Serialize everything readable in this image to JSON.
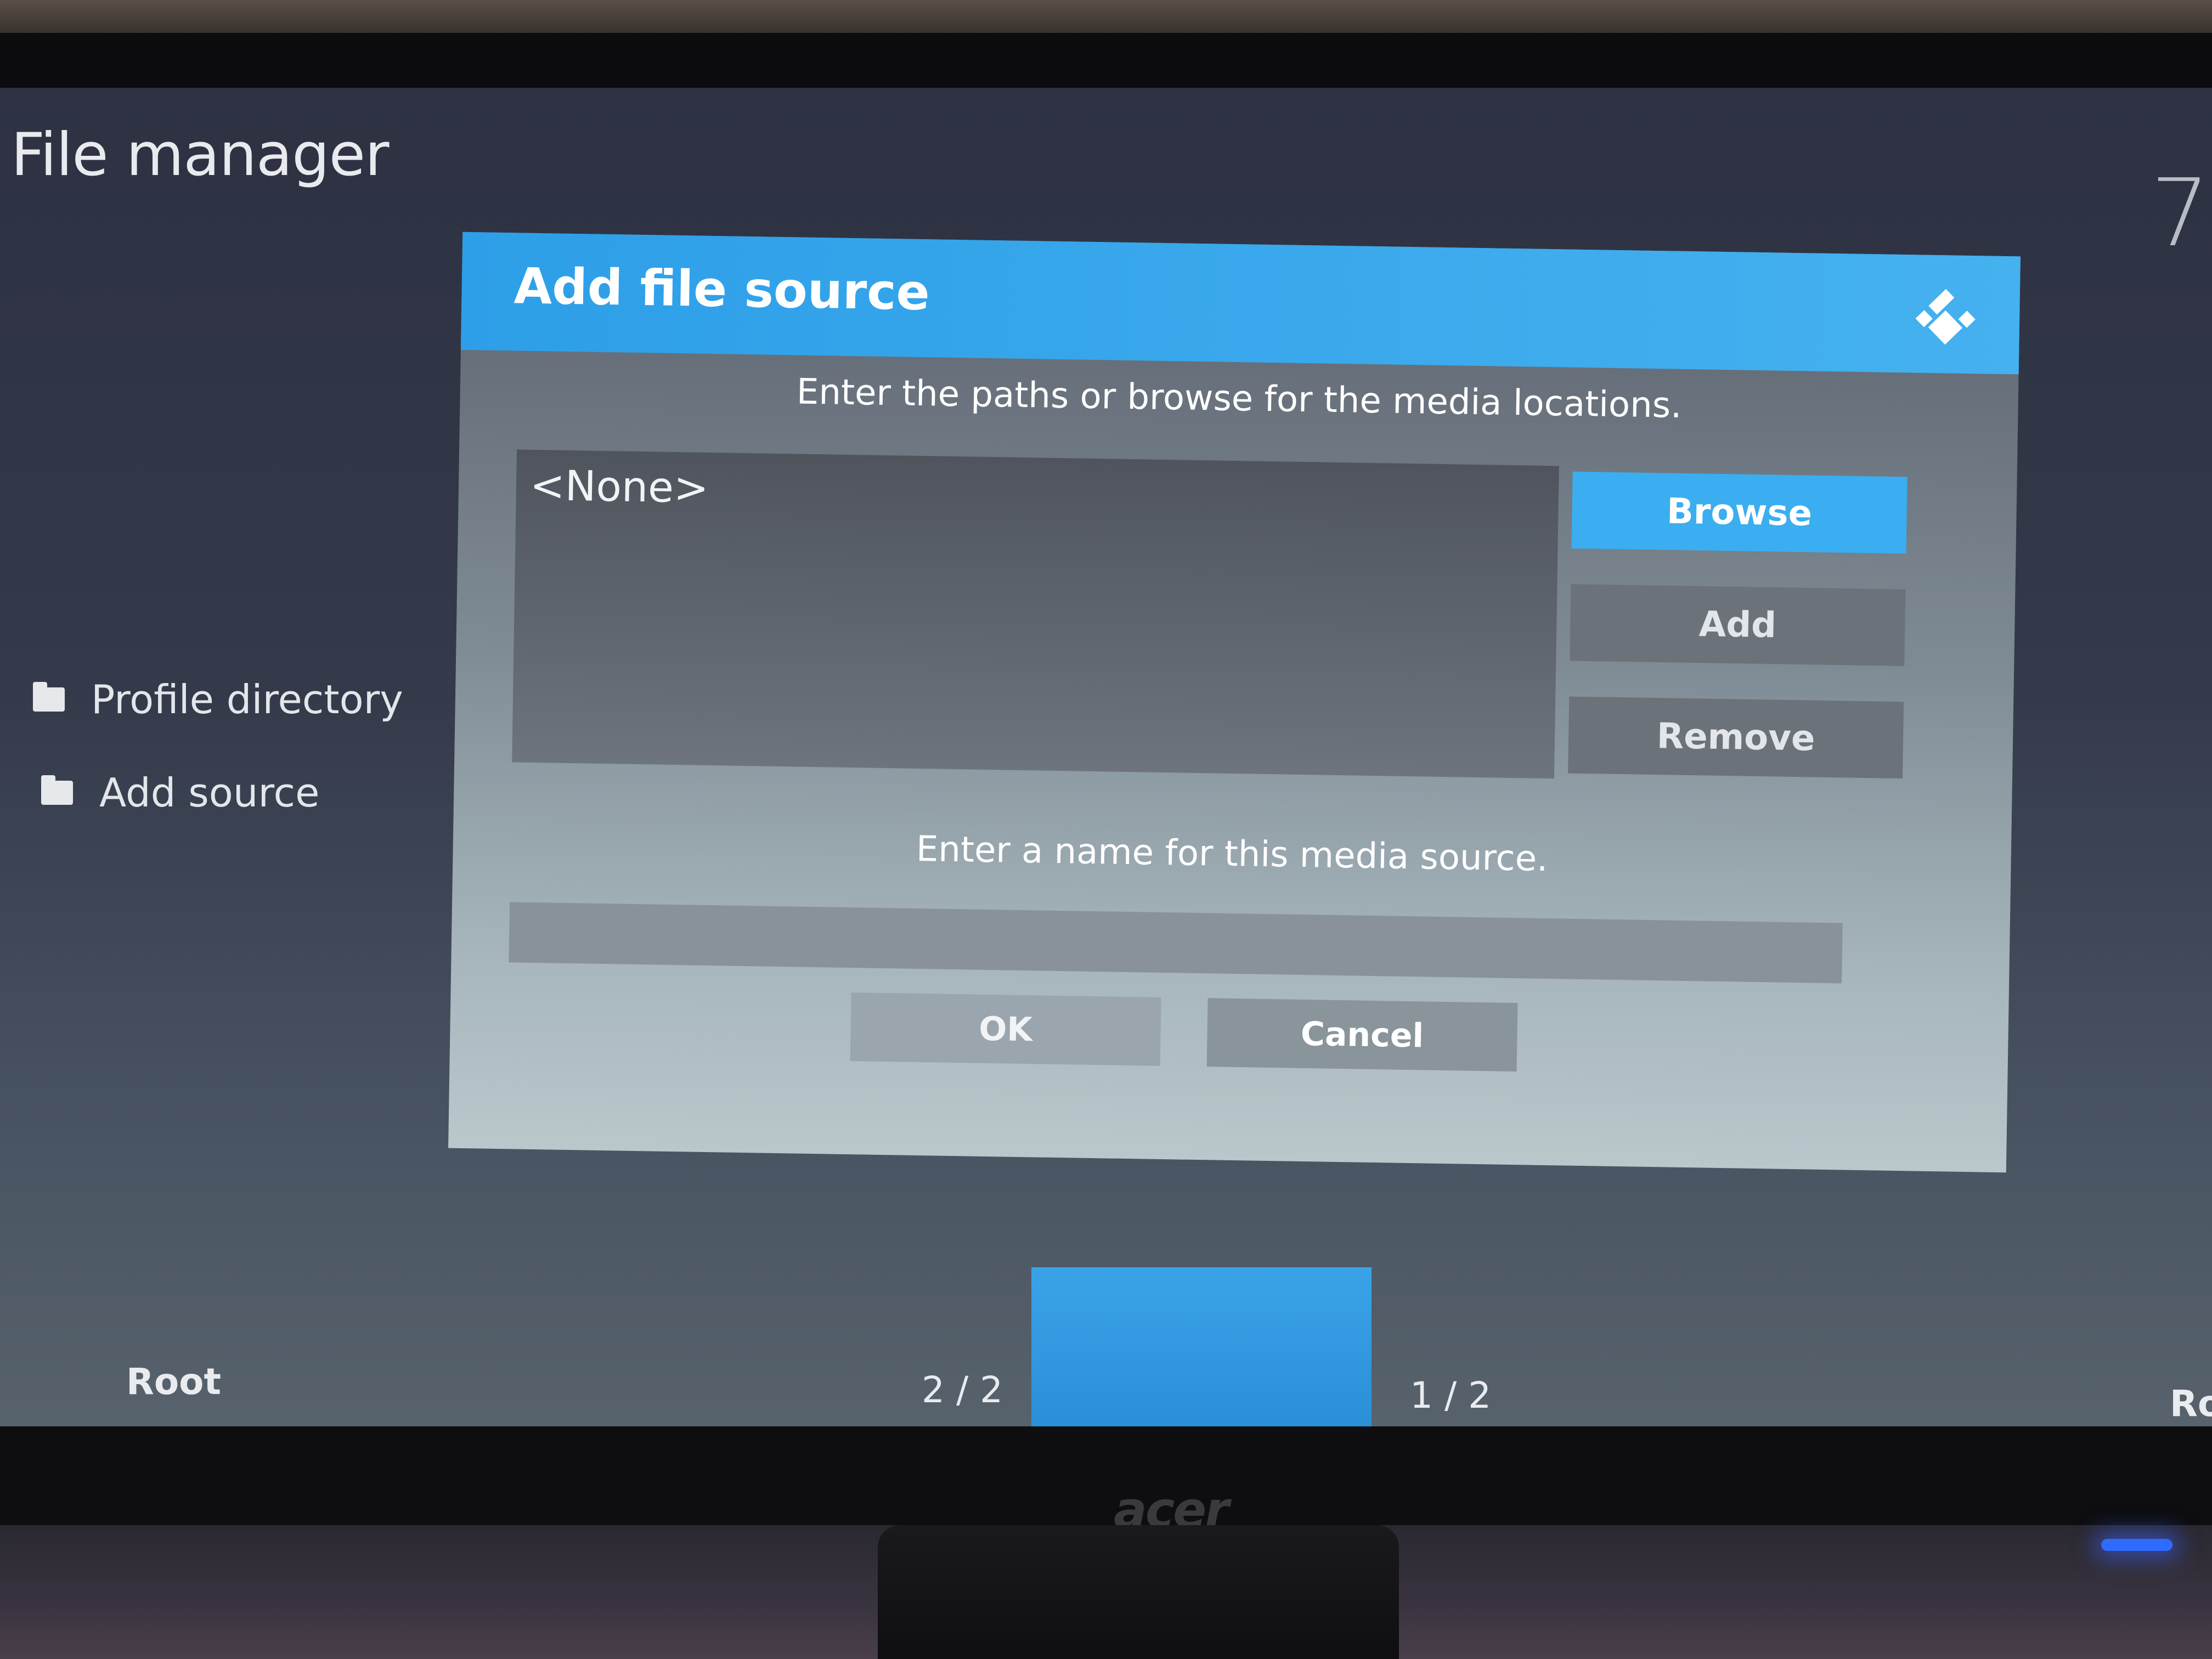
{
  "app": {
    "title": "File manager",
    "clock": "7:"
  },
  "sidebar": {
    "items": [
      {
        "label": "Profile directory",
        "icon": "folder-icon"
      },
      {
        "label": "Add source",
        "icon": "folder-icon"
      }
    ]
  },
  "footer": {
    "left_label": "Root",
    "left_count": "2 / 2",
    "right_count": "1 / 2",
    "right_label": "Ro"
  },
  "dialog": {
    "title": "Add file source",
    "paths_prompt": "Enter the paths or browse for the media locations.",
    "paths": [
      "<None>"
    ],
    "browse_label": "Browse",
    "add_label": "Add",
    "remove_label": "Remove",
    "name_prompt": "Enter a name for this media source.",
    "name_value": "",
    "ok_label": "OK",
    "cancel_label": "Cancel"
  },
  "monitor": {
    "brand": "acer"
  },
  "colors": {
    "accent": "#3aaef0",
    "header": "#2d9fe8"
  }
}
